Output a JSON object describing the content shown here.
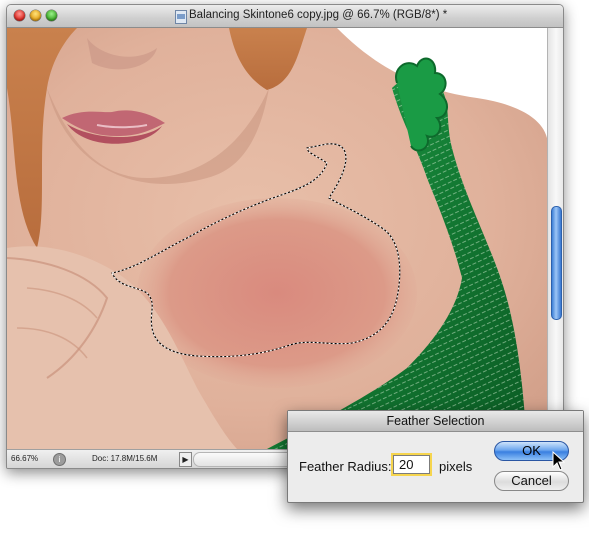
{
  "window": {
    "title": "Balancing Skintone6 copy.jpg @ 66.7% (RGB/8*) *",
    "icon": "document-icon"
  },
  "status_bar": {
    "zoom": "66.67%",
    "doc_size": "Doc: 17.8M/15.6M",
    "arrow": "▶",
    "info_icon": "i"
  },
  "dialog": {
    "title": "Feather Selection",
    "field_label": "Feather Radius:",
    "field_value": "20",
    "units": "pixels",
    "ok_label": "OK",
    "cancel_label": "Cancel"
  },
  "colors": {
    "dress_green": "#148a3a",
    "skin": "#e2b6a0",
    "ok_blue": "#3a7fe0",
    "focus_ring": "#f6d54e"
  }
}
